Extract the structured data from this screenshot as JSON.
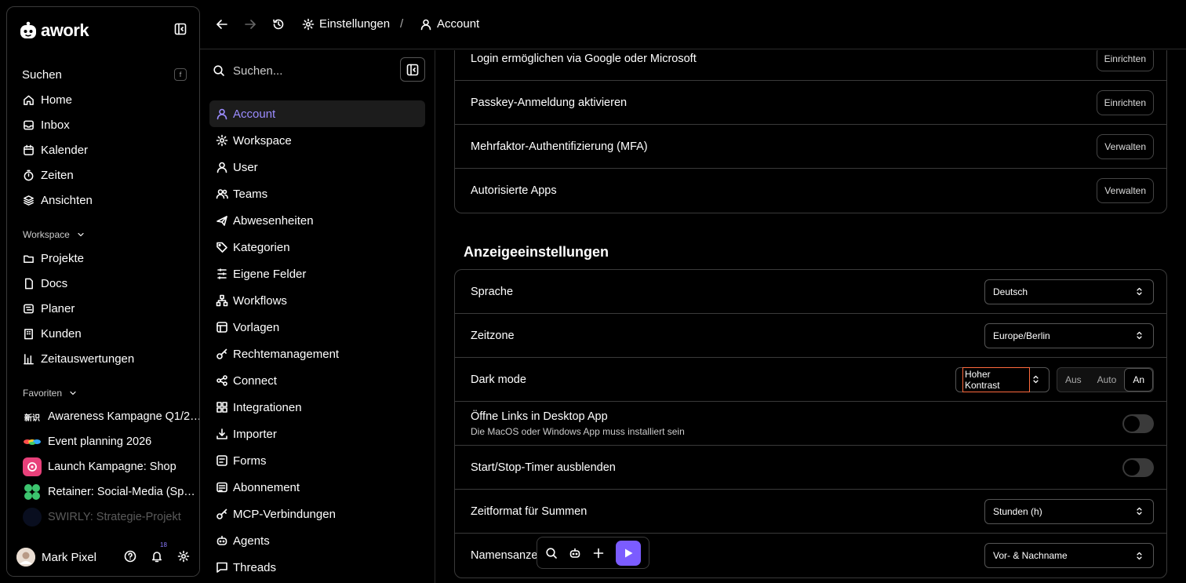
{
  "app": {
    "logo": "awork",
    "sidebar": {
      "search": {
        "label": "Suchen",
        "shortcut": "f"
      },
      "items": [
        {
          "label": "Home",
          "icon": "home-icon"
        },
        {
          "label": "Inbox",
          "icon": "inbox-icon"
        },
        {
          "label": "Kalender",
          "icon": "calendar-icon"
        },
        {
          "label": "Zeiten",
          "icon": "timer-icon"
        },
        {
          "label": "Ansichten",
          "icon": "layers-icon"
        }
      ],
      "workspace_label": "Workspace",
      "workspace_items": [
        {
          "label": "Projekte",
          "icon": "folder-icon"
        },
        {
          "label": "Docs",
          "icon": "doc-icon"
        },
        {
          "label": "Planer",
          "icon": "planner-icon"
        },
        {
          "label": "Kunden",
          "icon": "building-icon"
        },
        {
          "label": "Zeitauswertungen",
          "icon": "chart-icon"
        }
      ],
      "favorites_label": "Favoriten",
      "favorites": [
        {
          "label": "Awareness Kampagne Q1/2…",
          "color": "#000000"
        },
        {
          "label": "Event planning 2026",
          "color": "#000000"
        },
        {
          "label": "Launch Kampagne: Shop",
          "color": "#e8407a"
        },
        {
          "label": "Retainer: Social-Media (Sp…",
          "color": "#3cc46e"
        },
        {
          "label": "SWIRLY: Strategie-Projekt",
          "color": "#1a2a5a"
        }
      ],
      "user": {
        "name": "Mark Pixel",
        "notifications": "18"
      }
    }
  },
  "topbar": {
    "crumb_parent": "Einstellungen",
    "separator": "/",
    "crumb_current": "Account"
  },
  "settings_nav": {
    "search_placeholder": "Suchen...",
    "items": [
      {
        "label": "Account",
        "icon": "user-icon",
        "active": true
      },
      {
        "label": "Workspace",
        "icon": "gear-icon"
      },
      {
        "label": "User",
        "icon": "user-icon"
      },
      {
        "label": "Teams",
        "icon": "team-icon"
      },
      {
        "label": "Abwesenheiten",
        "icon": "plane-icon"
      },
      {
        "label": "Kategorien",
        "icon": "tag-icon"
      },
      {
        "label": "Eigene Felder",
        "icon": "fields-icon"
      },
      {
        "label": "Workflows",
        "icon": "workflow-icon"
      },
      {
        "label": "Vorlagen",
        "icon": "template-icon"
      },
      {
        "label": "Rechtemanagement",
        "icon": "key-icon"
      },
      {
        "label": "Connect",
        "icon": "connect-icon"
      },
      {
        "label": "Integrationen",
        "icon": "integration-icon"
      },
      {
        "label": "Importer",
        "icon": "import-icon"
      },
      {
        "label": "Forms",
        "icon": "form-icon"
      },
      {
        "label": "Abonnement",
        "icon": "subscription-icon"
      },
      {
        "label": "MCP-Verbindungen",
        "icon": "key-icon"
      },
      {
        "label": "Agents",
        "icon": "robot-icon"
      },
      {
        "label": "Threads",
        "icon": "chat-icon"
      }
    ]
  },
  "security": {
    "rows": [
      {
        "label": "Login ermöglichen via Google oder Microsoft",
        "action": "Einrichten"
      },
      {
        "label": "Passkey-Anmeldung aktivieren",
        "action": "Einrichten"
      },
      {
        "label": "Mehrfaktor-Authentifizierung (MFA)",
        "action": "Verwalten"
      },
      {
        "label": "Autorisierte Apps",
        "action": "Verwalten"
      }
    ]
  },
  "display": {
    "heading": "Anzeigeeinstellungen",
    "language": {
      "label": "Sprache",
      "value": "Deutsch"
    },
    "timezone": {
      "label": "Zeitzone",
      "value": "Europe/Berlin"
    },
    "dark_mode": {
      "label": "Dark mode",
      "contrast": "Hoher Kontrast",
      "options": [
        "Aus",
        "Auto",
        "An"
      ],
      "selected": "An"
    },
    "desktop_links": {
      "label": "Öffne Links in Desktop App",
      "sub": "Die MacOS oder Windows App muss installiert sein",
      "enabled": false
    },
    "timer": {
      "label": "Start/Stop-Timer ausblenden",
      "enabled": false
    },
    "time_format": {
      "label": "Zeitformat für Summen",
      "value": "Stunden (h)"
    },
    "name_display": {
      "label": "Namensanzeige",
      "value": "Vor- & Nachname"
    }
  },
  "colors": {
    "accent": "#7b5cff",
    "active_text": "#9b8cff",
    "highlight": "#ff6a3d"
  }
}
